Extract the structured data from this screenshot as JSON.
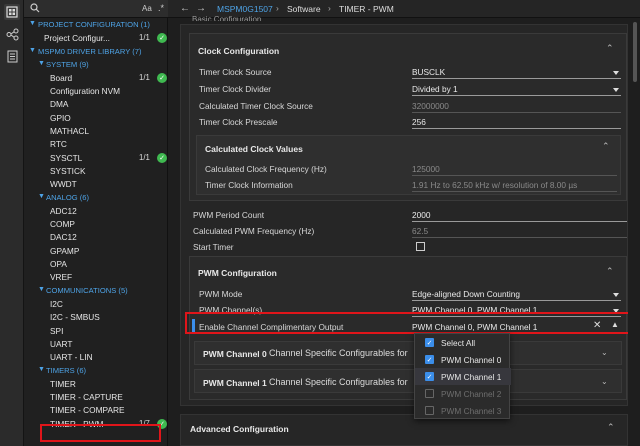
{
  "search": {
    "aa_label": "Aa",
    "placeholder": ""
  },
  "tree": {
    "sections": [
      {
        "label": "PROJECT CONFIGURATION (1)"
      },
      {
        "label": "MSPM0 DRIVER LIBRARY (7)"
      }
    ],
    "project_item": {
      "label": "Project Configur...",
      "count": "1/1"
    },
    "groups": {
      "system": "SYSTEM (9)",
      "analog": "ANALOG (6)",
      "communications": "COMMUNICATIONS (5)",
      "timers": "TIMERS (6)"
    },
    "system_items": [
      {
        "label": "Board",
        "count": "1/1"
      },
      {
        "label": "Configuration NVM"
      },
      {
        "label": "DMA"
      },
      {
        "label": "GPIO"
      },
      {
        "label": "MATHACL"
      },
      {
        "label": "RTC"
      },
      {
        "label": "SYSCTL",
        "count": "1/1"
      },
      {
        "label": "SYSTICK"
      },
      {
        "label": "WWDT"
      }
    ],
    "analog_items": [
      {
        "label": "ADC12"
      },
      {
        "label": "COMP"
      },
      {
        "label": "DAC12"
      },
      {
        "label": "GPAMP"
      },
      {
        "label": "OPA"
      },
      {
        "label": "VREF"
      }
    ],
    "comm_items": [
      {
        "label": "I2C"
      },
      {
        "label": "I2C - SMBUS"
      },
      {
        "label": "SPI"
      },
      {
        "label": "UART"
      },
      {
        "label": "UART - LIN"
      }
    ],
    "timer_items": [
      {
        "label": "TIMER"
      },
      {
        "label": "TIMER - CAPTURE"
      },
      {
        "label": "TIMER - COMPARE"
      },
      {
        "label": "TIMER - PWM",
        "count": "1/7"
      }
    ]
  },
  "breadcrumb": {
    "device": "MSPM0G1507",
    "sep1": "›",
    "software": "Software",
    "sep2": "›",
    "module": "TIMER - PWM"
  },
  "basic_cut": "Basic Configuration",
  "clock": {
    "title": "Clock Configuration",
    "fields": [
      {
        "label": "Timer Clock Source",
        "value": "BUSCLK"
      },
      {
        "label": "Timer Clock Divider",
        "value": "Divided by 1"
      },
      {
        "label": "Calculated Timer Clock Source",
        "value": "32000000"
      },
      {
        "label": "Timer Clock Prescale",
        "value": "256"
      }
    ],
    "values_title": "Calculated Clock Values",
    "calc_fields": [
      {
        "label": "Calculated Clock Frequency (Hz)",
        "value": "125000"
      },
      {
        "label": "Timer Clock Information",
        "value": "1.91 Hz to 62.50 kHz w/ resolution of 8.00 µs"
      }
    ]
  },
  "pwm_period": {
    "label": "PWM Period Count",
    "value": "2000"
  },
  "pwm_freq": {
    "label": "Calculated PWM Frequency (Hz)",
    "value": "62.5"
  },
  "start_timer": {
    "label": "Start Timer"
  },
  "pwm_config": {
    "title": "PWM Configuration",
    "mode": {
      "label": "PWM Mode",
      "value": "Edge-aligned Down Counting"
    },
    "channels": {
      "label": "PWM Channel(s)",
      "value": "PWM Channel 0, PWM Channel 1"
    },
    "compl": {
      "label": "Enable Channel Complimentary Output",
      "value": "PWM Channel 0, PWM Channel 1"
    },
    "ch0": {
      "title": "PWM Channel 0",
      "desc": "Channel Specific Configurables for"
    },
    "ch1": {
      "title": "PWM Channel 1",
      "desc": "Channel Specific Configurables for"
    }
  },
  "dropdown": [
    {
      "label": "Select All",
      "checked": true
    },
    {
      "label": "PWM Channel 0",
      "checked": true
    },
    {
      "label": "PWM Channel 1",
      "checked": true
    },
    {
      "label": "PWM Channel 2",
      "checked": false
    },
    {
      "label": "PWM Channel 3",
      "checked": false
    }
  ],
  "advanced": {
    "title": "Advanced Configuration"
  },
  "colors": {
    "accent": "#3b8eea",
    "section": "#4ea3e6",
    "check": "#3fb950",
    "highlight": "#e0151a"
  }
}
